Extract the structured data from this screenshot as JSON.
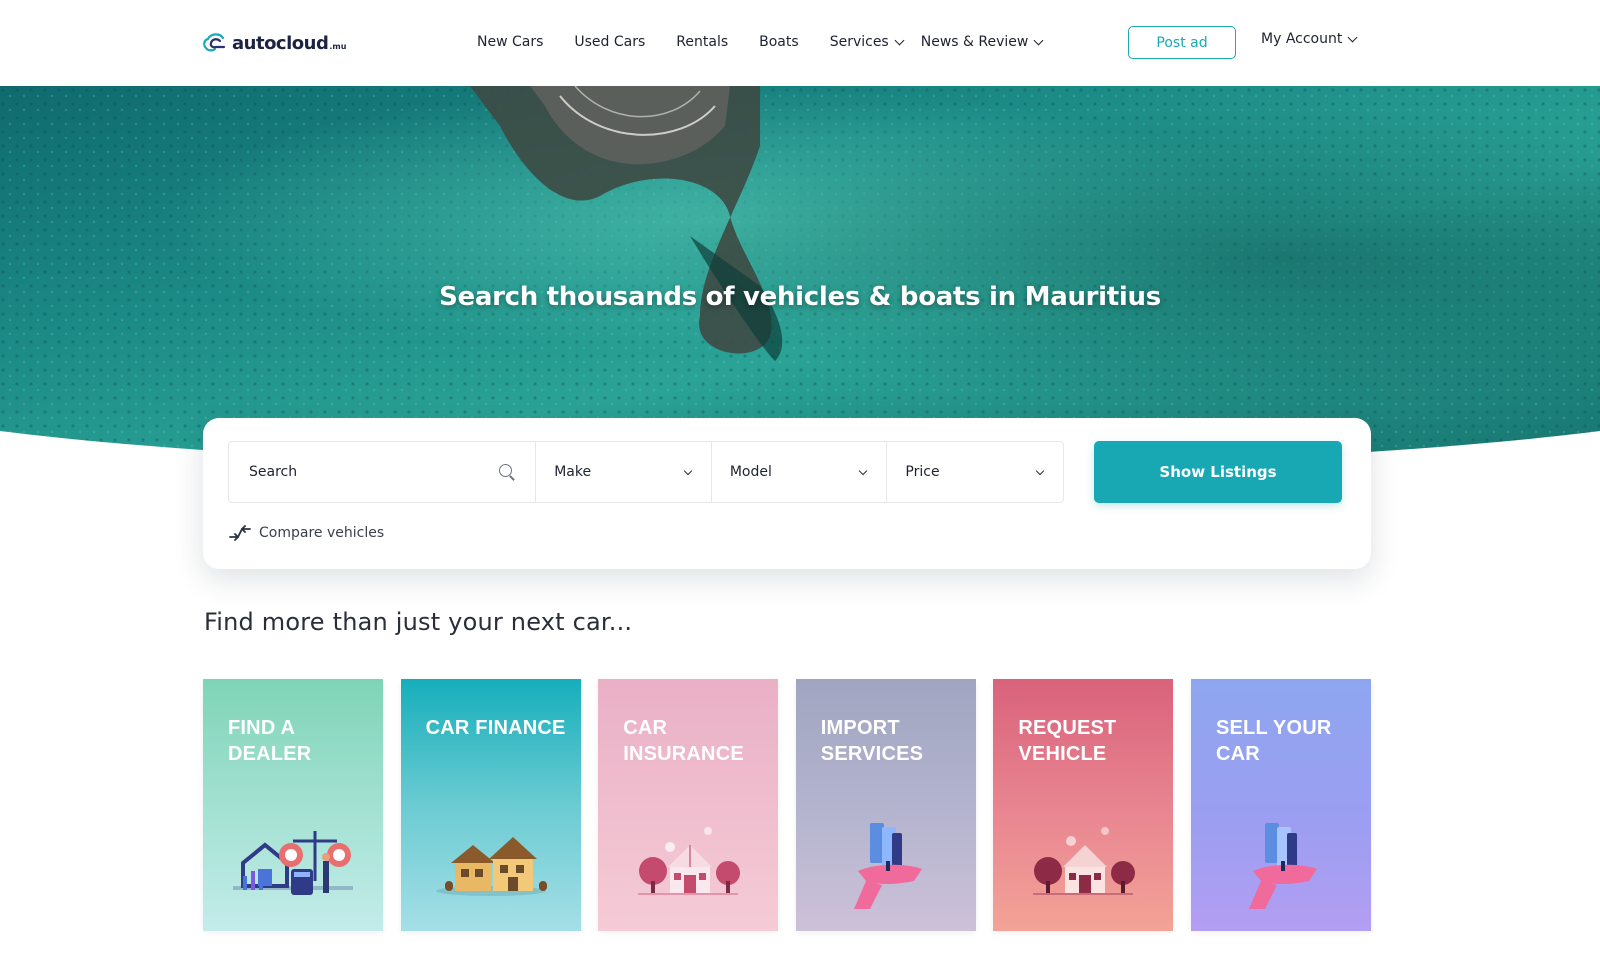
{
  "header": {
    "logo_text": "autocloud",
    "logo_tld": ".mu",
    "nav": [
      {
        "label": "New Cars",
        "dropdown": false
      },
      {
        "label": "Used Cars",
        "dropdown": false
      },
      {
        "label": "Rentals",
        "dropdown": false
      },
      {
        "label": "Boats",
        "dropdown": false
      },
      {
        "label": "Services",
        "dropdown": true
      },
      {
        "label": "News & Review",
        "dropdown": true
      }
    ],
    "post_ad_label": "Post ad",
    "account_label": "My Account"
  },
  "hero": {
    "title": "Search thousands of vehicles & boats in Mauritius"
  },
  "search": {
    "search_placeholder": "Search",
    "make_label": "Make",
    "model_label": "Model",
    "price_label": "Price",
    "show_button": "Show Listings",
    "compare_label": "Compare vehicles"
  },
  "section": {
    "title": "Find more than just your next car..."
  },
  "cards": [
    {
      "title": "Find a dealer",
      "icon": "dealer-illustration-icon"
    },
    {
      "title": "Car finance",
      "icon": "house-illustration-icon"
    },
    {
      "title": "Car insurance",
      "icon": "insured-house-illustration-icon"
    },
    {
      "title": "Import services",
      "icon": "hand-documents-illustration-icon"
    },
    {
      "title": "Request vehicle",
      "icon": "house-trees-illustration-icon"
    },
    {
      "title": "Sell your car",
      "icon": "hand-documents-illustration-icon"
    }
  ],
  "colors": {
    "accent": "#17a8b4",
    "text": "#1f2330"
  }
}
